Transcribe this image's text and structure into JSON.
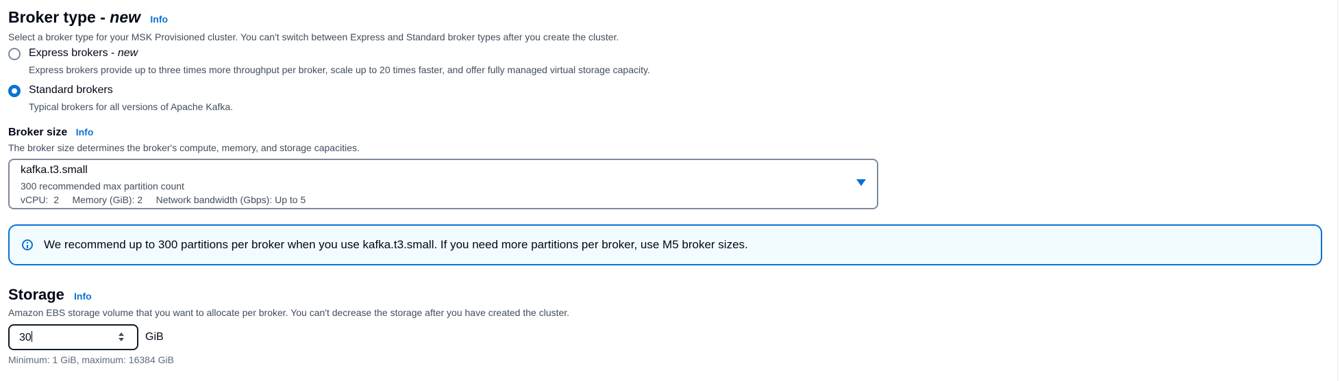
{
  "broker_type": {
    "title_prefix": "Broker type - ",
    "title_new": "new",
    "info": "Info",
    "description": "Select a broker type for your MSK Provisioned cluster. You can't switch between Express and Standard broker types after you create the cluster.",
    "options": [
      {
        "label": "Express brokers - ",
        "label_new": "new",
        "description": "Express brokers provide up to three times more throughput per broker, scale up to 20 times faster, and offer fully managed virtual storage capacity.",
        "selected": false
      },
      {
        "label": "Standard brokers",
        "label_new": "",
        "description": "Typical brokers for all versions of Apache Kafka.",
        "selected": true
      }
    ]
  },
  "broker_size": {
    "label": "Broker size",
    "info": "Info",
    "description": "The broker size determines the broker's compute, memory, and storage capacities.",
    "selected_value": "kafka.t3.small",
    "partition_note": "300 recommended max partition count",
    "specs": "vCPU:  2     Memory (GiB): 2     Network bandwidth (Gbps): Up to 5"
  },
  "alert": {
    "text": "We recommend up to 300 partitions per broker when you use kafka.t3.small. If you need more partitions per broker, use M5 broker sizes."
  },
  "storage": {
    "title": "Storage",
    "info": "Info",
    "description": "Amazon EBS storage volume that you want to allocate per broker. You can't decrease the storage after you have created the cluster.",
    "value": "30",
    "unit": "GiB",
    "constraint": "Minimum: 1 GiB, maximum: 16384 GiB"
  },
  "colors": {
    "accent": "#0972d3",
    "alert_bg": "#f2fcff",
    "text": "#000716",
    "secondary_text": "#414d5c"
  }
}
